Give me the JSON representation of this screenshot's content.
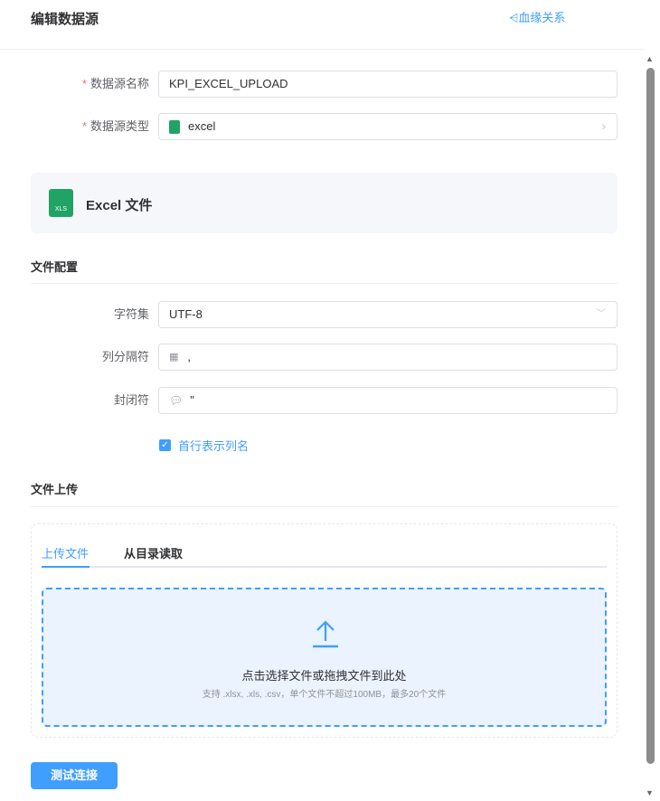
{
  "header": {
    "title": "编辑数据源",
    "lineage_link": "血缘关系"
  },
  "form": {
    "name": {
      "label": "数据源名称",
      "value": "KPI_EXCEL_UPLOAD",
      "required": "*"
    },
    "type": {
      "label": "数据源类型",
      "value": "excel",
      "required": "*"
    }
  },
  "type_card": {
    "title": "Excel 文件",
    "icon_text": "XLS"
  },
  "file_config": {
    "title": "文件配置",
    "charset": {
      "label": "字符集",
      "value": "UTF-8"
    },
    "delimiter": {
      "label": "列分隔符",
      "value": ","
    },
    "enclosure": {
      "label": "封闭符",
      "value": "\""
    },
    "header_row": {
      "label": "首行表示列名",
      "checked": true
    }
  },
  "upload": {
    "title": "文件上传",
    "tabs": [
      {
        "label": "上传文件",
        "active": true
      },
      {
        "label": "从目录读取",
        "active": false
      }
    ],
    "drop_text": "点击选择文件或拖拽文件到此处",
    "hint": "支持 .xlsx, .xls, .csv，单个文件不超过100MB，最多20个文件"
  },
  "actions": {
    "test_connection": "测试连接"
  },
  "colors": {
    "primary": "#409eff",
    "excel": "#21a366"
  }
}
